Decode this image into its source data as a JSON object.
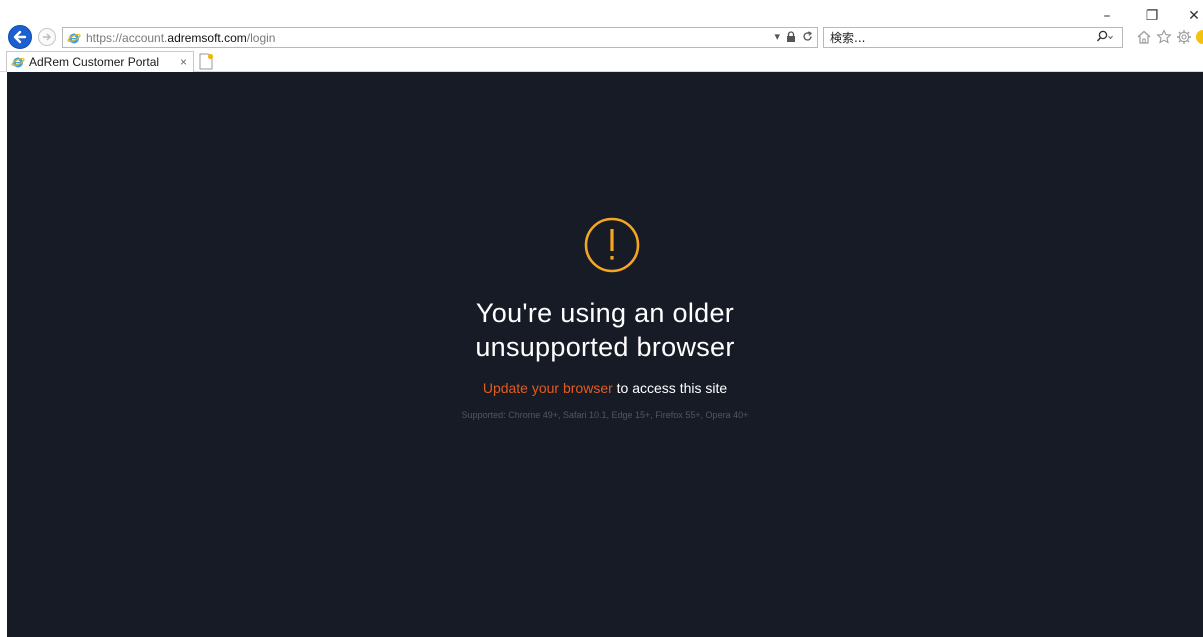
{
  "window": {
    "minimize": "–",
    "restore": "❐",
    "close": "✕"
  },
  "address_bar": {
    "scheme": "https://",
    "subdomain": "account.",
    "host": "adremsoft.com",
    "path": "/login",
    "dropdown": "▾"
  },
  "search": {
    "placeholder": "検索..."
  },
  "tab": {
    "title": "AdRem Customer Portal",
    "close": "×"
  },
  "page": {
    "headline_line1": "You're using an older",
    "headline_line2": "unsupported browser",
    "update_link": "Update your browser",
    "update_rest": " to access this site",
    "supported": "Supported: Chrome 49+, Safari 10.1, Edge 15+, Firefox 55+, Opera 40+"
  },
  "colors": {
    "background": "#161b26",
    "accent_orange": "#f5a524",
    "link_orange": "#e35b1f",
    "ie_blue": "#1c5fcf"
  }
}
